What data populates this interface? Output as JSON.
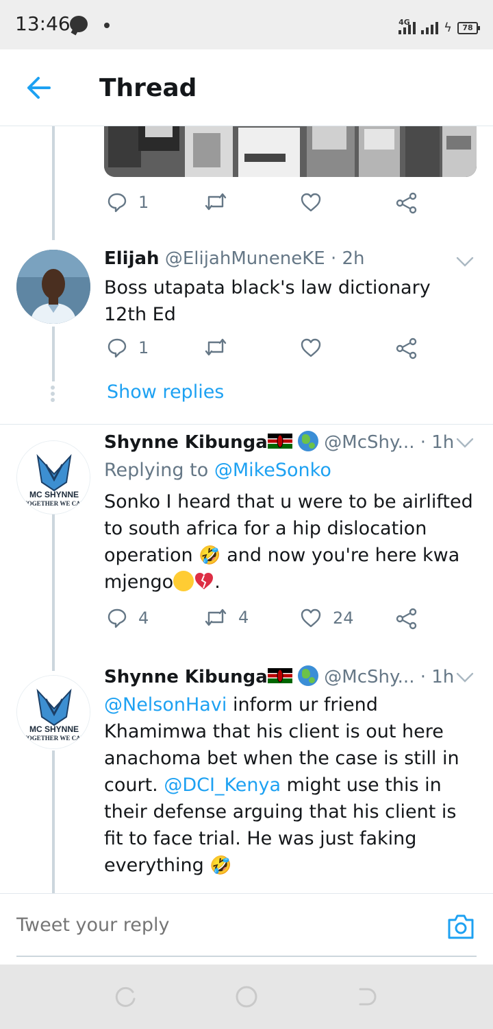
{
  "status_bar": {
    "time": "13:46",
    "network": "4G",
    "battery": "78"
  },
  "header": {
    "title": "Thread",
    "back_icon": "arrow-left-icon"
  },
  "media_tweet_actions": {
    "reply_count": "1",
    "retweet_count": "",
    "like_count": ""
  },
  "tweets": [
    {
      "name": "Elijah",
      "handle": "@ElijahMuneneKE",
      "separator": "·",
      "time": "2h",
      "text": "Boss utapata black's law dictionary 12th Ed",
      "reply_count": "1",
      "retweet_count": "",
      "like_count": "",
      "show_replies": "Show replies"
    },
    {
      "name": "Shynne Kibunga",
      "handle": "@McShy...",
      "separator": "·",
      "time": "1h",
      "replying_prefix": "Replying to",
      "replying_to": "@MikeSonko",
      "text_part1": "Sonko I heard that u were to be airlifted to south africa for a hip dislocation operation",
      "text_part2": "and now you're here kwa mjengo",
      "text_part3": ".",
      "reply_count": "4",
      "retweet_count": "4",
      "like_count": "24",
      "avatar_text_1": "MC SHYNNE",
      "avatar_text_2": "TOGETHER WE CAN"
    },
    {
      "name": "Shynne Kibunga",
      "handle": "@McShy...",
      "separator": "·",
      "time": "1h",
      "mention_1": "@NelsonHavi",
      "text_part1": "inform ur friend Khamimwa that his client is out here anachoma bet when the case is still in court.",
      "mention_2": "@DCI_Kenya",
      "text_part2": "might use this in their defense arguing that his client is fit to face trial. He was just faking everything",
      "avatar_text_1": "MC SHYNNE",
      "avatar_text_2": "TOGETHER WE CAN"
    }
  ],
  "reply_bar": {
    "placeholder": "Tweet your reply"
  },
  "colors": {
    "accent": "#1da1f2",
    "secondary_text": "#657786",
    "thread_line": "#ccd6dd"
  }
}
